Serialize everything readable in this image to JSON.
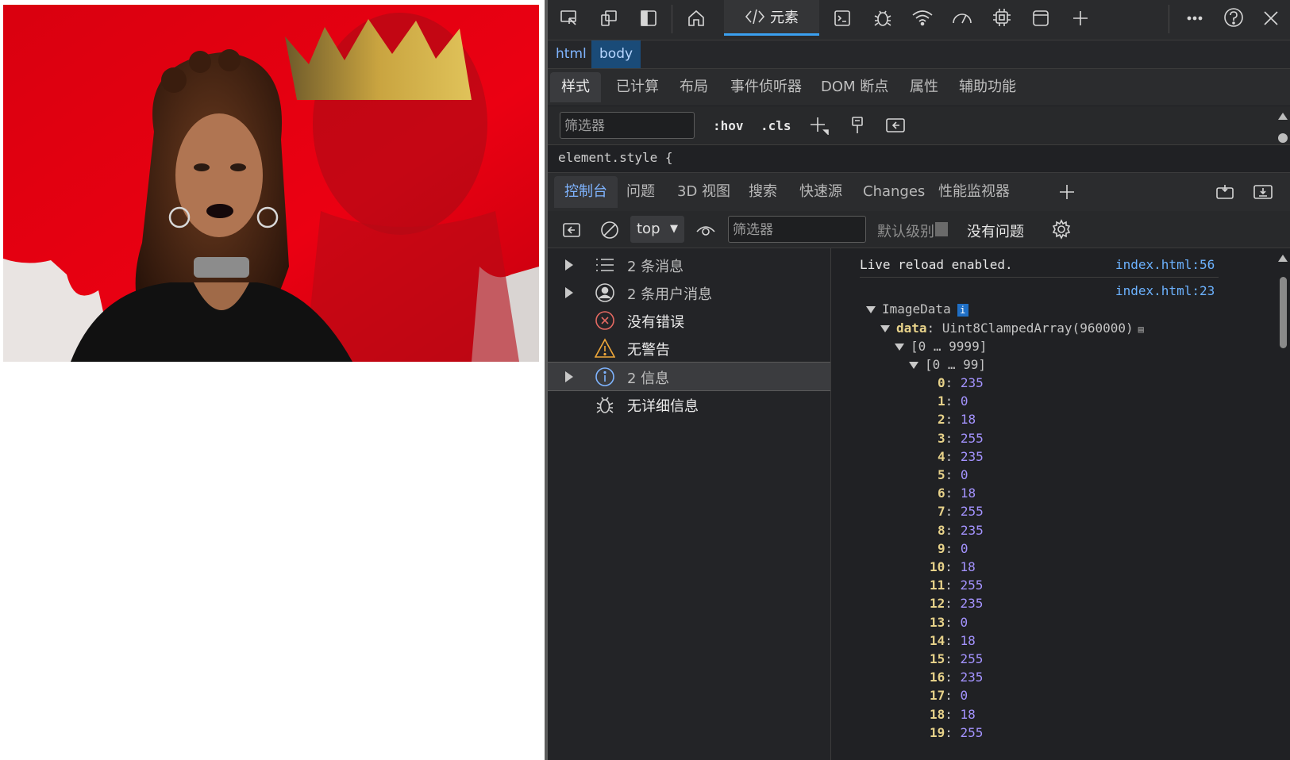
{
  "breadcrumb": [
    "html",
    "body"
  ],
  "toolbar": {
    "elements_tab_label": "元素",
    "icons": [
      "inspect-icon",
      "device-emulation-icon",
      "dock-sidebar-icon",
      "home-icon",
      "elements-code-icon",
      "console-icon",
      "bug-icon",
      "wifi-icon",
      "performance-gauge-icon",
      "cpu-chip-icon",
      "application-window-icon",
      "plus-icon",
      "more-icon",
      "help-icon",
      "close-icon"
    ]
  },
  "styles_tabs": [
    "样式",
    "已计算",
    "布局",
    "事件侦听器",
    "DOM 断点",
    "属性",
    "辅助功能"
  ],
  "styles_toolbar": {
    "filter_placeholder": "筛选器",
    "hov_label": ":hov",
    "cls_label": ".cls"
  },
  "element_style_text": "element.style {",
  "drawer_tabs": [
    "控制台",
    "问题",
    "3D 视图",
    "搜索",
    "快速源",
    "Changes",
    "性能监视器"
  ],
  "console_toolbar": {
    "context": "top",
    "filter_placeholder": "筛选器",
    "levels_label": "默认级别",
    "issues_label": "没有问题"
  },
  "sidebar": [
    {
      "label": "2 条消息",
      "icon": "list-icon"
    },
    {
      "label": "2 条用户消息",
      "icon": "user-icon"
    },
    {
      "label": "没有错误",
      "icon": "error-icon"
    },
    {
      "label": "无警告",
      "icon": "warning-icon"
    },
    {
      "label": "2 信息",
      "icon": "info-icon"
    },
    {
      "label": "无详细信息",
      "icon": "bug-icon"
    }
  ],
  "console": {
    "message1": "Live reload enabled.",
    "source1": "index.html:56",
    "source2": "index.html:23",
    "object_name": "ImageData",
    "info_badge": "i",
    "data_key": "data",
    "data_value": "Uint8ClampedArray(960000)",
    "range_outer": "[0 … 9999]",
    "range_inner": "[0 … 99]",
    "entries": [
      {
        "index": "0",
        "value": "235"
      },
      {
        "index": "1",
        "value": "0"
      },
      {
        "index": "2",
        "value": "18"
      },
      {
        "index": "3",
        "value": "255"
      },
      {
        "index": "4",
        "value": "235"
      },
      {
        "index": "5",
        "value": "0"
      },
      {
        "index": "6",
        "value": "18"
      },
      {
        "index": "7",
        "value": "255"
      },
      {
        "index": "8",
        "value": "235"
      },
      {
        "index": "9",
        "value": "0"
      },
      {
        "index": "10",
        "value": "18"
      },
      {
        "index": "11",
        "value": "255"
      },
      {
        "index": "12",
        "value": "235"
      },
      {
        "index": "13",
        "value": "0"
      },
      {
        "index": "14",
        "value": "18"
      },
      {
        "index": "15",
        "value": "255"
      },
      {
        "index": "16",
        "value": "235"
      },
      {
        "index": "17",
        "value": "0"
      },
      {
        "index": "18",
        "value": "18"
      },
      {
        "index": "19",
        "value": "255"
      }
    ]
  },
  "colors": {
    "accent": "#3aa0f0",
    "link": "#6cb2ff",
    "key": "#e7d28a",
    "number": "#a493ff",
    "photo_red": "#eb0012"
  }
}
